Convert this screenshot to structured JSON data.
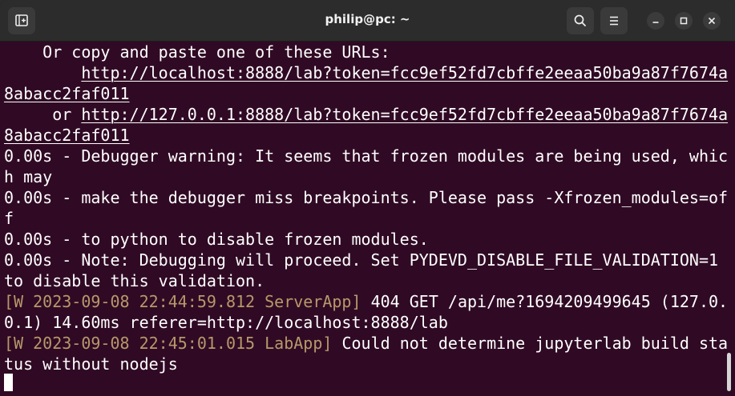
{
  "window": {
    "title": "philip@pc: ~"
  },
  "titlebar": {
    "new_tab_icon": "new-tab-icon",
    "search_icon": "search-icon",
    "menu_icon": "hamburger-menu-icon",
    "minimize_icon": "minimize-icon",
    "maximize_icon": "maximize-icon",
    "close_icon": "close-icon"
  },
  "terminal": {
    "colors": {
      "background": "#300a24",
      "foreground": "#ffffff",
      "log_prefix": "#b7986b"
    },
    "lines": [
      {
        "t": "    Or copy and paste one of these URLs:"
      },
      {
        "t": "        ",
        "u": "http://localhost:8888/lab?token=fcc9ef52fd7cbffe2eeaa50ba9a87f7674a"
      },
      {
        "u": "8abacc2faf011"
      },
      {
        "t": "     or ",
        "u": "http://127.0.0.1:8888/lab?token=fcc9ef52fd7cbffe2eeaa50ba9a87f7674a"
      },
      {
        "u": "8abacc2faf011"
      },
      {
        "t": "0.00s - Debugger warning: It seems that frozen modules are being used, whic"
      },
      {
        "t": "h may"
      },
      {
        "t": "0.00s - make the debugger miss breakpoints. Please pass -Xfrozen_modules=of"
      },
      {
        "t": "f"
      },
      {
        "t": "0.00s - to python to disable frozen modules."
      },
      {
        "t": "0.00s - Note: Debugging will proceed. Set PYDEVD_DISABLE_FILE_VALIDATION=1"
      },
      {
        "t": "to disable this validation."
      },
      {
        "p": "[W 2023-09-08 22:44:59.812 ServerApp]",
        "t": " 404 GET /api/me?1694209499645 (127.0."
      },
      {
        "t": "0.1) 14.60ms referer=http://localhost:8888/lab"
      },
      {
        "p": "[W 2023-09-08 22:45:01.015 LabApp]",
        "t": " Could not determine jupyterlab build sta"
      },
      {
        "t": "tus without nodejs"
      }
    ]
  }
}
